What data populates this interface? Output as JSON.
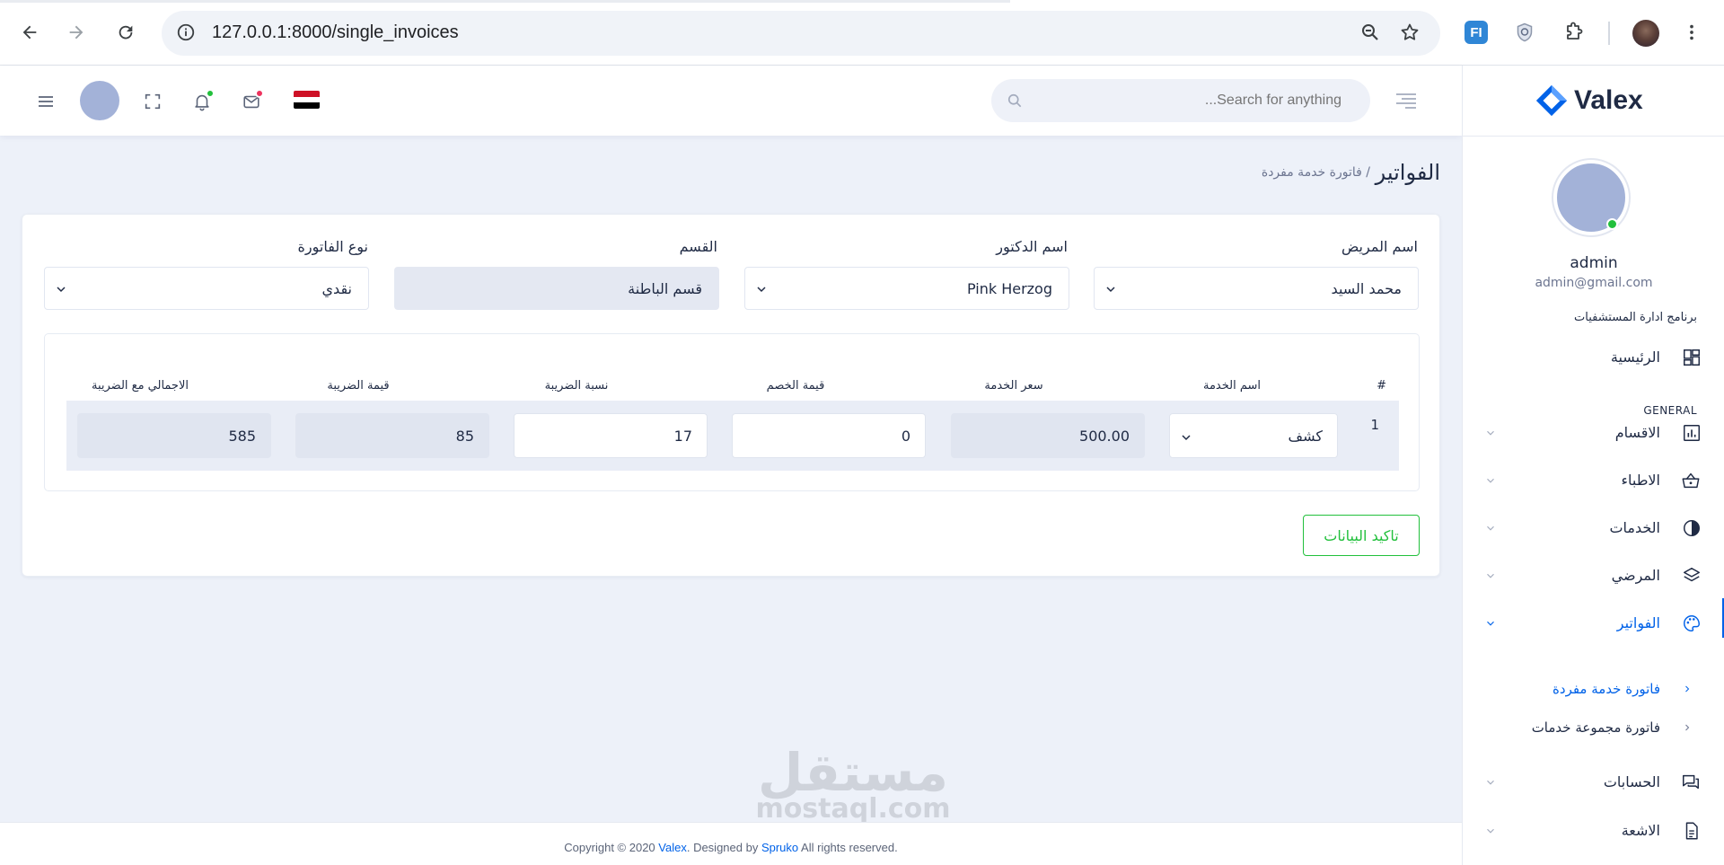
{
  "browser": {
    "url": "127.0.0.1:8000/single_invoices"
  },
  "header": {
    "search_placeholder": "Search for anything...",
    "accent_color": "#0162e8",
    "notification_dot_color": "#22c03c",
    "mail_dot_color": "#ee335e"
  },
  "sidebar": {
    "logo_text": "Valex",
    "user_name": "admin",
    "user_email": "admin@gmail.com",
    "category": "برنامج ادارة المستشفيات",
    "general": "GENERAL",
    "home": "الرئيسية",
    "items": [
      {
        "label": "الاقسام"
      },
      {
        "label": "الاطباء"
      },
      {
        "label": "الخدمات"
      },
      {
        "label": "المرضي"
      },
      {
        "label": "الفواتير"
      }
    ],
    "subitems": [
      {
        "label": "فاتورة خدمة مفردة"
      },
      {
        "label": "فاتورة مجموعة خدمات"
      }
    ],
    "items_bottom": [
      {
        "label": "الحسابات"
      },
      {
        "label": "الاشعة"
      }
    ]
  },
  "page": {
    "title": "الفواتير",
    "breadcrumb": "/ فاتورة خدمة مفردة"
  },
  "form": {
    "patient_label": "اسم المريض",
    "patient_value": "محمد السيد",
    "doctor_label": "اسم الدكتور",
    "doctor_value": "Pink Herzog",
    "section_label": "القسم",
    "section_value": "قسم الباطنة",
    "type_label": "نوع الفاتورة",
    "type_value": "نقدي"
  },
  "table": {
    "headers": [
      "#",
      "اسم الخدمة",
      "سعر الخدمة",
      "قيمة الخصم",
      "نسبة الضريبة",
      "قيمة الضريبة",
      "الاجمالي مع الضريبة"
    ],
    "row": {
      "num": "1",
      "service": "كشف",
      "price": "500.00",
      "discount": "0",
      "tax_rate": "17",
      "tax_value": "85",
      "total": "585"
    }
  },
  "submit_label": "تاكيد البيانات",
  "watermark": {
    "ar": "مستقل",
    "en": "mostaql.com"
  },
  "footer": {
    "prefix": "Copyright © 2020 ",
    "brand": "Valex",
    "mid": ". Designed by ",
    "designer": "Spruko",
    "suffix": " All rights reserved."
  }
}
